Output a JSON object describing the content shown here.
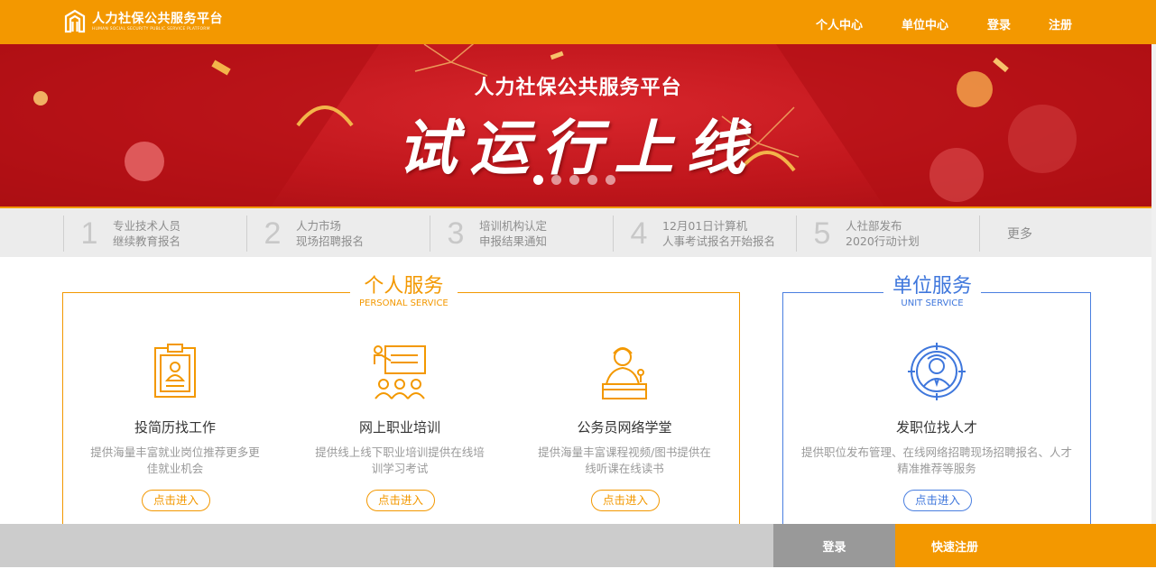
{
  "colors": {
    "accent": "#f39800",
    "unit": "#3f77dc",
    "banner": "#c0161c"
  },
  "header": {
    "logo_cn": "人力社保公共服务平台",
    "logo_en": "HUMAN SOCIAL SECURITY PUBLIC SERVICE PLATFORM",
    "nav": [
      "个人中心",
      "单位中心",
      "登录",
      "注册"
    ]
  },
  "banner": {
    "title": "人力社保公共服务平台",
    "headline": "试运行上线",
    "slides": 5,
    "active_slide": 1
  },
  "notices": [
    {
      "num": "1",
      "line1": "专业技术人员",
      "line2": "继续教育报名"
    },
    {
      "num": "2",
      "line1": "人力市场",
      "line2": "现场招聘报名"
    },
    {
      "num": "3",
      "line1": "培训机构认定",
      "line2": "申报结果通知"
    },
    {
      "num": "4",
      "line1": "12月01日计算机",
      "line2": "人事考试报名开始报名"
    },
    {
      "num": "5",
      "line1": "人社部发布",
      "line2": "2020行动计划"
    }
  ],
  "more_label": "更多",
  "personal": {
    "title_cn": "个人服务",
    "title_en": "PERSONAL SERVICE",
    "items": [
      {
        "icon": "resume-clipboard-icon",
        "title": "投简历找工作",
        "desc": "提供海量丰富就业岗位推荐更多更佳就业机会",
        "button": "点击进入"
      },
      {
        "icon": "training-classroom-icon",
        "title": "网上职业培训",
        "desc": "提供线上线下职业培训提供在线培训学习考试",
        "button": "点击进入"
      },
      {
        "icon": "speaker-podium-icon",
        "title": "公务员网络学堂",
        "desc": "提供海量丰富课程视频/图书提供在线听课在线读书",
        "button": "点击进入"
      }
    ]
  },
  "unit": {
    "title_cn": "单位服务",
    "title_en": "UNIT SERVICE",
    "items": [
      {
        "icon": "target-person-icon",
        "title": "发职位找人才",
        "desc": "提供职位发布管理、在线网络招聘现场招聘报名、人才精准推荐等服务",
        "button": "点击进入"
      }
    ]
  },
  "bottom": {
    "login": "登录",
    "register": "快速注册"
  }
}
